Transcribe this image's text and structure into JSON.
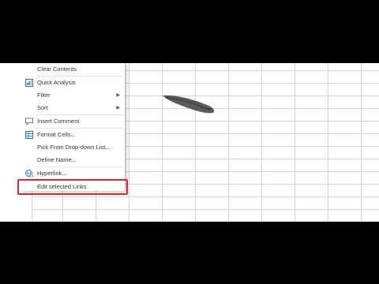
{
  "context_menu": {
    "items": [
      {
        "label": "Clear Contents",
        "icon": "",
        "submenu": false
      },
      {
        "label": "Quick Analysis",
        "icon": "quick-analysis-icon",
        "submenu": false
      },
      {
        "label": "Filter",
        "icon": "",
        "submenu": true
      },
      {
        "label": "Sort",
        "icon": "",
        "submenu": true
      },
      {
        "label": "Insert Comment",
        "icon": "comment-icon",
        "submenu": false
      },
      {
        "label": "Format Cells...",
        "icon": "format-cells-icon",
        "submenu": false
      },
      {
        "label": "Pick From Drop-down List...",
        "icon": "",
        "submenu": false
      },
      {
        "label": "Define Name...",
        "icon": "",
        "submenu": false
      },
      {
        "label": "Hyperlink...",
        "icon": "hyperlink-icon",
        "submenu": false
      },
      {
        "label": "Edit selected Links",
        "icon": "",
        "submenu": false
      }
    ],
    "highlighted_item": "Edit selected Links",
    "highlight_color": "#d62836"
  },
  "colors": {
    "letterbox": "#000000",
    "gridline": "#d4d4d4",
    "icon_blue": "#2e6fb7"
  }
}
